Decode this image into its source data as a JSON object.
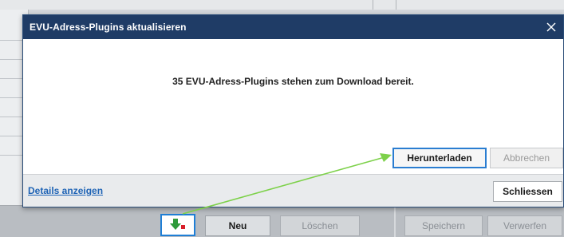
{
  "dialog": {
    "title": "EVU-Adress-Plugins aktualisieren",
    "close_glyph": "✕",
    "message": "35 EVU-Adress-Plugins stehen zum Download bereit.",
    "download_label": "Herunterladen",
    "cancel_label": "Abbrechen",
    "details_link": "Details anzeigen",
    "close_label": "Schliessen"
  },
  "toolbar": {
    "new_label": "Neu",
    "delete_label": "Löschen",
    "save_label": "Speichern",
    "discard_label": "Verwerfen"
  },
  "colors": {
    "titlebar": "#1f3c66",
    "accent_blue": "#2a7dd1",
    "annotation_arrow": "#7dd14a",
    "download_icon_green": "#2e9a3a",
    "download_icon_red": "#d8202a",
    "link": "#1e63b5"
  },
  "icons": {
    "download_plugins": "download-arrow-icon",
    "dialog_close": "close-icon"
  }
}
